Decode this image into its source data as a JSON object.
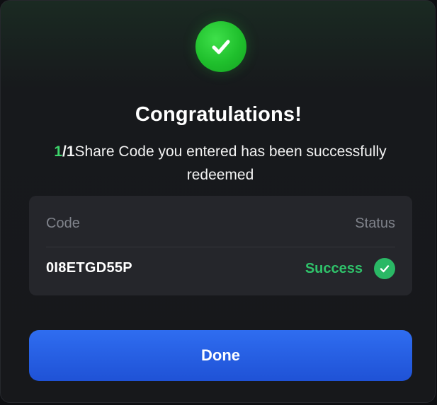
{
  "dialog": {
    "title": "Congratulations!",
    "message": {
      "success_count": "1",
      "separator": "/",
      "total_count": "1",
      "text": "Share Code you entered has been successfully redeemed"
    }
  },
  "table": {
    "headers": {
      "code": "Code",
      "status": "Status"
    },
    "rows": [
      {
        "code": "0I8ETGD55P",
        "status": "Success"
      }
    ]
  },
  "actions": {
    "done_label": "Done"
  },
  "colors": {
    "success_green": "#2fc26a",
    "accent_blue": "#2f6df0"
  },
  "icons": {
    "header": "check-circle-icon",
    "row_status": "check-circle-icon"
  }
}
